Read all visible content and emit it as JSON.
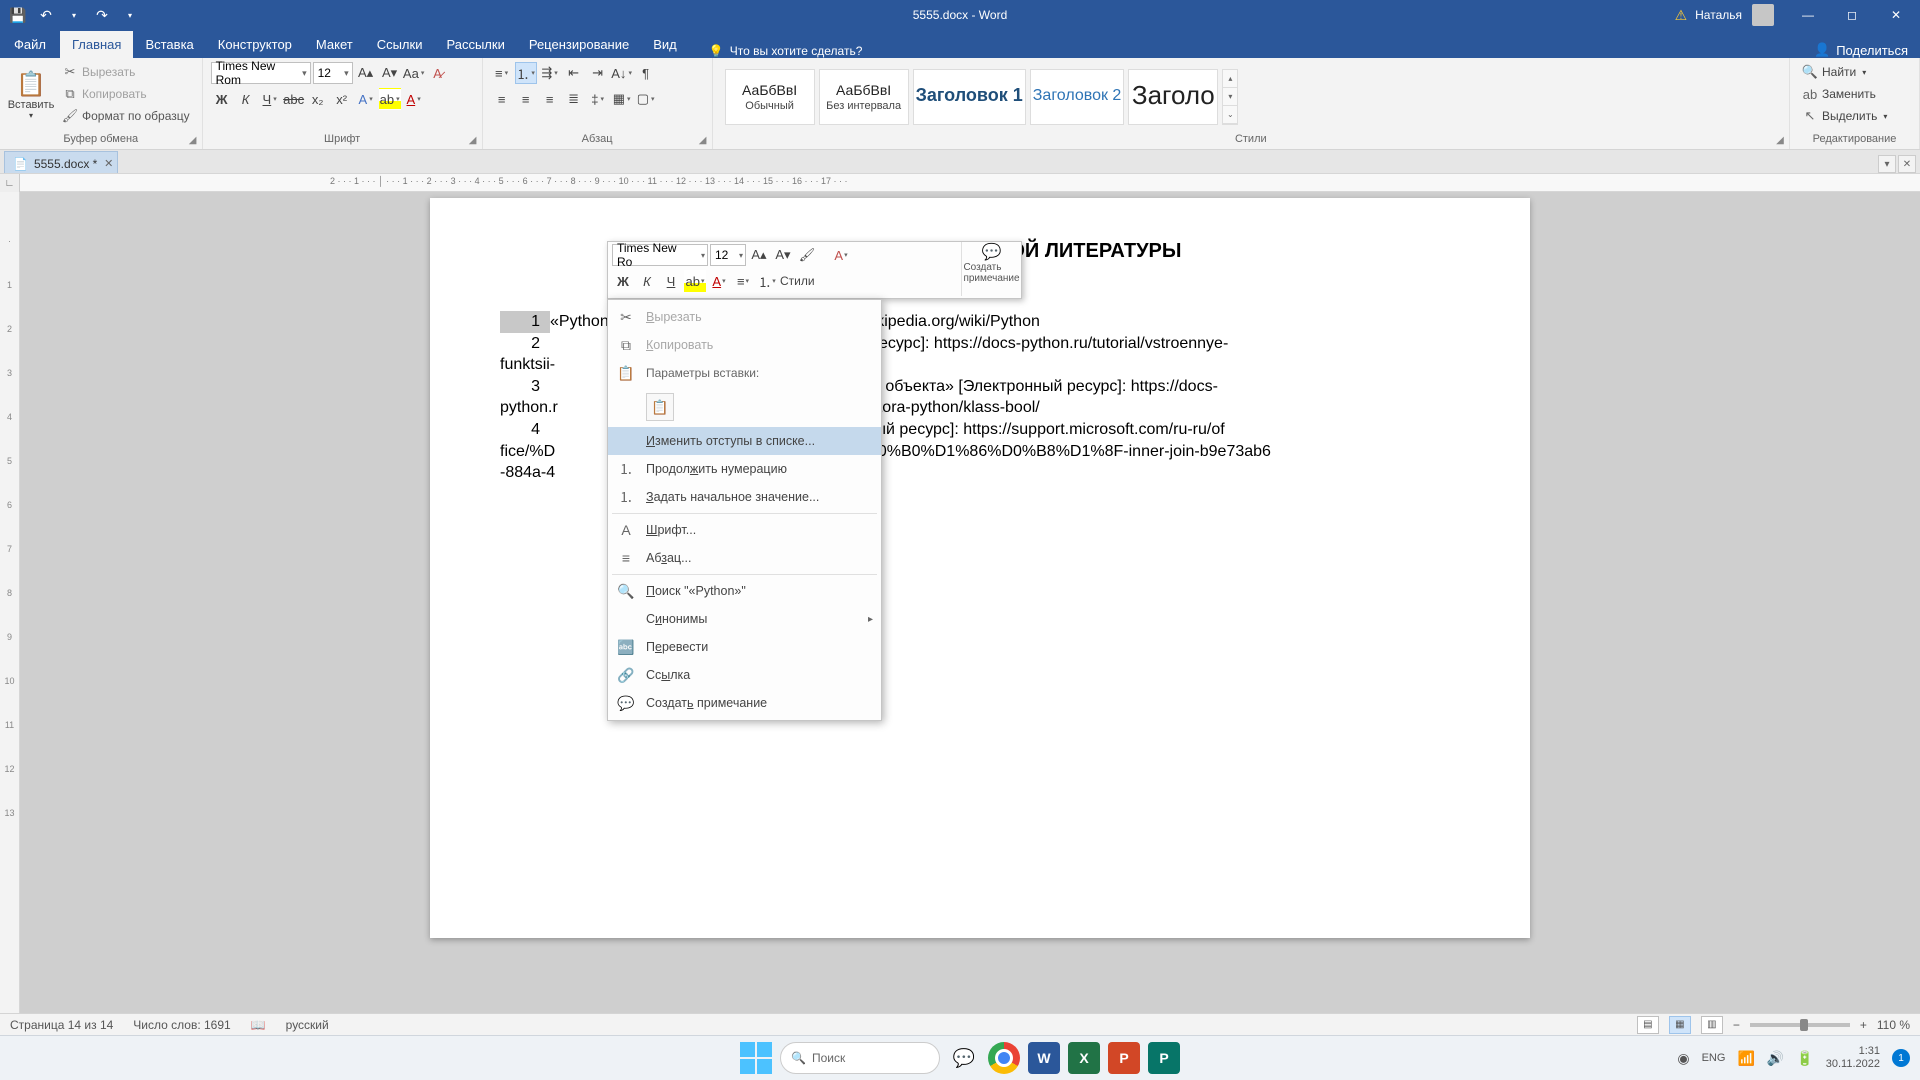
{
  "titlebar": {
    "document_title": "5555.docx - Word",
    "user_name": "Наталья",
    "share": "Поделиться"
  },
  "tabs": {
    "file": "Файл",
    "home": "Главная",
    "insert": "Вставка",
    "design": "Конструктор",
    "layout": "Макет",
    "references": "Ссылки",
    "mailings": "Рассылки",
    "review": "Рецензирование",
    "view": "Вид",
    "tell_me": "Что вы хотите сделать?"
  },
  "ribbon": {
    "clipboard": {
      "paste": "Вставить",
      "cut": "Вырезать",
      "copy": "Копировать",
      "format_painter": "Формат по образцу",
      "label": "Буфер обмена"
    },
    "font": {
      "name": "Times New Rom",
      "size": "12",
      "label": "Шрифт"
    },
    "paragraph": {
      "label": "Абзац"
    },
    "styles": {
      "label": "Стили",
      "items": [
        "Обычный",
        "Без интервала",
        "Заголовок 1",
        "Заголовок 2",
        "Заголо"
      ]
    },
    "editing": {
      "find": "Найти",
      "replace": "Заменить",
      "select": "Выделить",
      "label": "Редактирование"
    }
  },
  "doctab": {
    "name": "5555.docx *"
  },
  "ruler": "2 · · · 1 · · · │ · · · 1 · · · 2 · · · 3 · · · 4 · · · 5 · · · 6 · · · 7 · · · 8 · · · 9 · · · 10 · · · 11 · · · 12 · · · 13 · · · 14 · · · 15 · · · 16 · · · 17 · · ·",
  "document": {
    "title": "СПИСОК ИСПОЛЬЗУЕМОЙ ЛИТЕРАТУРЫ",
    "lines": {
      "l1_num": "1",
      "l1_a": "«Python» [Электронный ресурс]: https://ru.wikipedia.org/wiki/Python",
      "l2_num": "2",
      "l2_b": "Электронный ресурс]: https://docs-python.ru/tutorial/vstroennye-",
      "l2_c": "funktsii-",
      "l2_d": "input/",
      "l3_num": "3",
      "l3_b": "еское   значение   объекта» [Электронный ресурс]: https://docs-",
      "l3_c": "python.r",
      "l3_d": "nterpretatora-python/klass-bool/",
      "l4_num": "4",
      "l4_b": "N» [Электронный ресурс]: https://support.microsoft.com/ru-ru/of",
      "l4_c": "fice/%D",
      "l4_d": "1%80%D0%B0%D1%86%D0%B8%D1%8F-inner-join-b9e73ab6",
      "l4_e": "-884a-4"
    }
  },
  "minitoolbar": {
    "font": "Times New Ro",
    "size": "12",
    "styles": "Стили",
    "create_note": "Создать примечание"
  },
  "context_menu": {
    "cut": "Вырезать",
    "copy": "Копировать",
    "paste_params": "Параметры вставки:",
    "adjust_indents": "Изменить отступы в списке...",
    "continue_numbering": "Продолжить нумерацию",
    "set_start_value": "Задать начальное значение...",
    "font": "Шрифт...",
    "paragraph": "Абзац...",
    "search": "Поиск \"«Python»\"",
    "synonyms": "Синонимы",
    "translate": "Перевести",
    "link": "Ссылка",
    "create_comment": "Создать примечание"
  },
  "statusbar": {
    "page": "Страница 14 из 14",
    "words": "Число слов: 1691",
    "lang": "русский",
    "zoom": "110 %"
  },
  "taskbar": {
    "search": "Поиск",
    "lang": "ENG",
    "time": "1:31",
    "date": "30.11.2022"
  }
}
